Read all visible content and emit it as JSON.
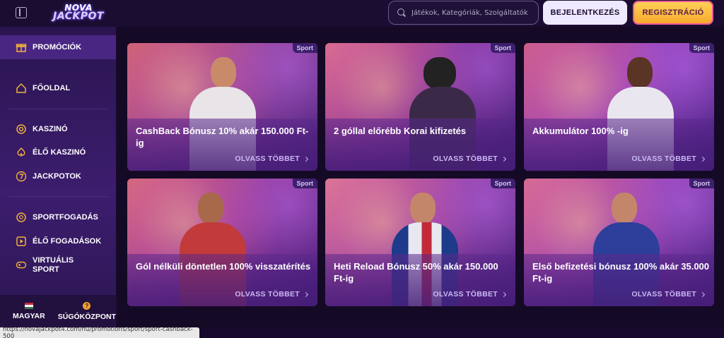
{
  "header": {
    "logo_line1": "NOVA",
    "logo_line2": "JACKPOT",
    "search_placeholder": "Játékok, Kategóriák, Szolgáltatók",
    "login_label": "BEJELENTKEZÉS",
    "register_label": "REGISZTRÁCIÓ"
  },
  "sidebar": {
    "items": [
      {
        "label": "PROMÓCIÓK",
        "icon": "gift-icon"
      },
      {
        "label": "FŐOLDAL",
        "icon": "home-icon"
      },
      {
        "label": "KASZINÓ",
        "icon": "casino-chip-icon"
      },
      {
        "label": "ÉLŐ KASZINÓ",
        "icon": "spade-icon"
      },
      {
        "label": "JACKPOTOK",
        "icon": "seven-icon"
      },
      {
        "label": "SPORTFOGADÁS",
        "icon": "ball-icon"
      },
      {
        "label": "ÉLŐ FOGADÁSOK",
        "icon": "play-icon"
      },
      {
        "label": "VIRTUÁLIS SPORT",
        "icon": "gamepad-icon"
      }
    ],
    "language_label": "MAGYAR",
    "help_label": "SÚGÓKÖZPONT"
  },
  "promotions": [
    {
      "title": "CashBack Bónusz 10% akár 150.000 Ft-ig",
      "tag": "Sport",
      "cta": "OLVASS TÖBBET"
    },
    {
      "title": "2 góllal előrébb Korai kifizetés",
      "tag": "Sport",
      "cta": "OLVASS TÖBBET"
    },
    {
      "title": "Akkumulátor 100% -ig",
      "tag": "Sport",
      "cta": "OLVASS TÖBBET"
    },
    {
      "title": "Gól nélküli döntetlen 100% visszatérítés",
      "tag": "Sport",
      "cta": "OLVASS TÖBBET"
    },
    {
      "title": "Heti Reload Bónusz 50% akár 150.000 Ft-ig",
      "tag": "Sport",
      "cta": "OLVASS TÖBBET"
    },
    {
      "title": "Első befizetési bónusz 100% akár 35.000 Ft-ig",
      "tag": "Sport",
      "cta": "OLVASS TÖBBET"
    }
  ],
  "status_url": "https://novajackpot4.com/hu/promotions/sport/sport-cashback-500",
  "colors": {
    "background": "#170a2c",
    "sidebar": "#3c1d6e",
    "accent_gold": "#f2b13c",
    "register_button": "#ffd35a"
  }
}
